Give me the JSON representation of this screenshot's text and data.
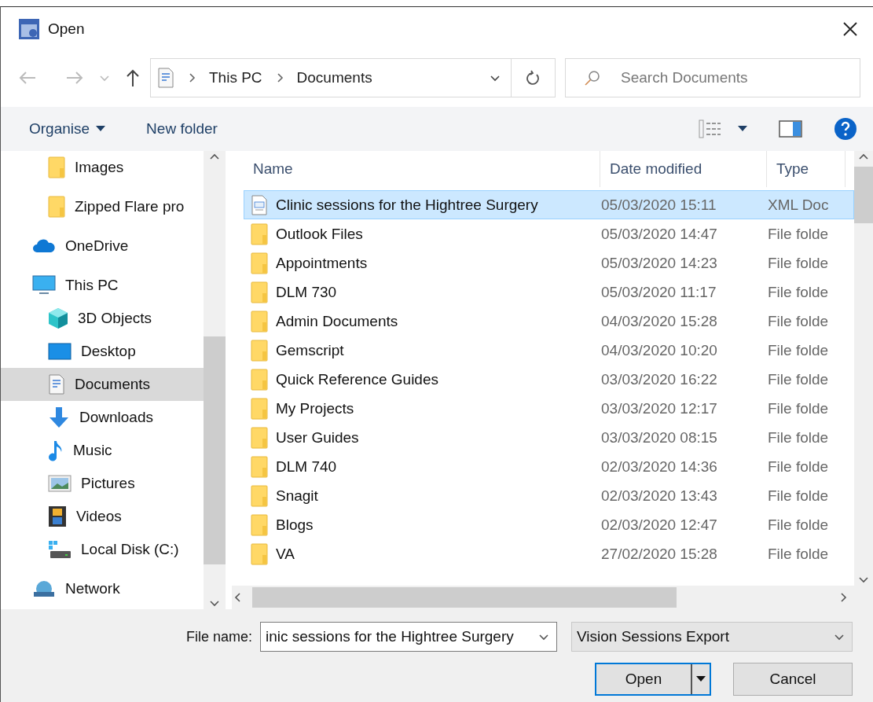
{
  "window": {
    "title": "Open"
  },
  "address": {
    "crumbs": [
      "This PC",
      "Documents"
    ]
  },
  "search": {
    "placeholder": "Search Documents"
  },
  "toolbar": {
    "buttons": [
      "Organise",
      "New folder"
    ]
  },
  "sidebar": {
    "items": [
      {
        "label": "Images",
        "kind": "folder",
        "selected": false
      },
      {
        "label": "Zipped Flare pro",
        "kind": "folder",
        "selected": false
      },
      {
        "label": "OneDrive",
        "kind": "cloud",
        "selected": false
      },
      {
        "label": "This PC",
        "kind": "pc",
        "selected": false,
        "children": [
          {
            "label": "3D Objects",
            "kind": "cube",
            "selected": false
          },
          {
            "label": "Desktop",
            "kind": "desktop",
            "selected": false
          },
          {
            "label": "Documents",
            "kind": "document",
            "selected": true
          },
          {
            "label": "Downloads",
            "kind": "download",
            "selected": false
          },
          {
            "label": "Music",
            "kind": "music",
            "selected": false
          },
          {
            "label": "Pictures",
            "kind": "pictures",
            "selected": false
          },
          {
            "label": "Videos",
            "kind": "videos",
            "selected": false
          },
          {
            "label": "Local Disk (C:)",
            "kind": "disk",
            "selected": false
          }
        ]
      },
      {
        "label": "Network",
        "kind": "network",
        "selected": false
      }
    ]
  },
  "table": {
    "columns": [
      "Name",
      "Date modified",
      "Type"
    ],
    "rows": [
      {
        "name": "Clinic sessions for the Hightree Surgery",
        "date": "05/03/2020 15:11",
        "type": "XML Doc",
        "kind": "xml",
        "selected": true
      },
      {
        "name": "Outlook Files",
        "date": "05/03/2020 14:47",
        "type": "File folde",
        "kind": "folder",
        "selected": false
      },
      {
        "name": "Appointments",
        "date": "05/03/2020 14:23",
        "type": "File folde",
        "kind": "folder",
        "selected": false
      },
      {
        "name": "DLM 730",
        "date": "05/03/2020 11:17",
        "type": "File folde",
        "kind": "folder",
        "selected": false
      },
      {
        "name": "Admin Documents",
        "date": "04/03/2020 15:28",
        "type": "File folde",
        "kind": "folder",
        "selected": false
      },
      {
        "name": "Gemscript",
        "date": "04/03/2020 10:20",
        "type": "File folde",
        "kind": "folder",
        "selected": false
      },
      {
        "name": "Quick Reference Guides",
        "date": "03/03/2020 16:22",
        "type": "File folde",
        "kind": "folder",
        "selected": false
      },
      {
        "name": "My Projects",
        "date": "03/03/2020 12:17",
        "type": "File folde",
        "kind": "folder",
        "selected": false
      },
      {
        "name": "User Guides",
        "date": "03/03/2020 08:15",
        "type": "File folde",
        "kind": "folder",
        "selected": false
      },
      {
        "name": "DLM 740",
        "date": "02/03/2020 14:36",
        "type": "File folde",
        "kind": "folder",
        "selected": false
      },
      {
        "name": "Snagit",
        "date": "02/03/2020 13:43",
        "type": "File folde",
        "kind": "folder",
        "selected": false
      },
      {
        "name": "Blogs",
        "date": "02/03/2020 12:47",
        "type": "File folde",
        "kind": "folder",
        "selected": false
      },
      {
        "name": "VA",
        "date": "27/02/2020 15:28",
        "type": "File folde",
        "kind": "folder",
        "selected": false
      }
    ]
  },
  "footer": {
    "file_name_label": "File name:",
    "file_name": "inic sessions for the Hightree Surgery",
    "file_type": "Vision Sessions Export",
    "buttons": [
      "Open",
      "Cancel"
    ]
  }
}
